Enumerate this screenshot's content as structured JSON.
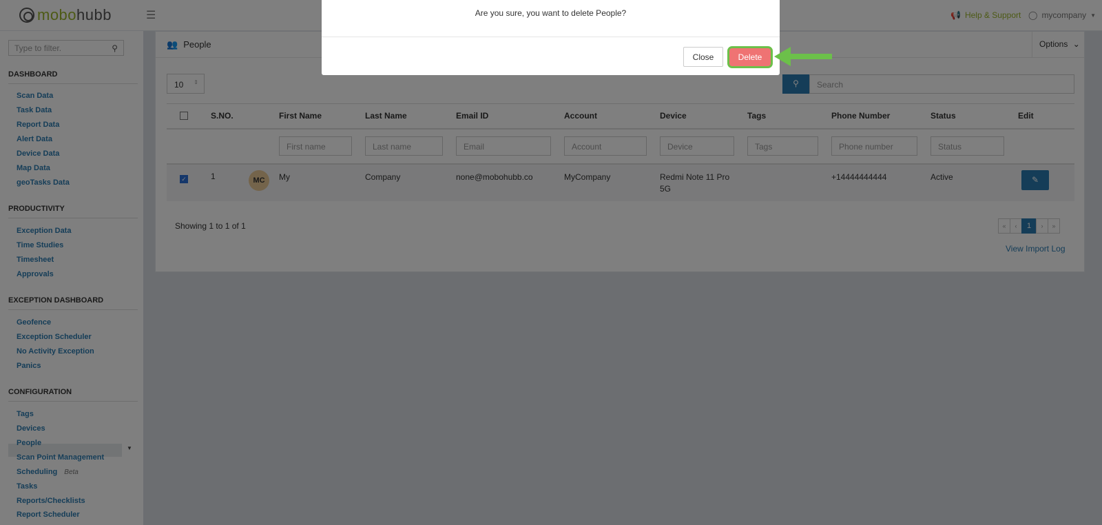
{
  "header": {
    "logo_part1": "mobo",
    "logo_part2": "hubb",
    "help_label": "Help & Support",
    "user_label": "mycompany"
  },
  "sidebar": {
    "filter_placeholder": "Type to filter.",
    "sections": {
      "dashboard": "DASHBOARD",
      "productivity": "PRODUCTIVITY",
      "exception": "EXCEPTION DASHBOARD",
      "configuration": "CONFIGURATION"
    },
    "dashboard_items": [
      "Scan Data",
      "Task Data",
      "Report Data",
      "Alert Data",
      "Device Data",
      "Map Data",
      "geoTasks Data"
    ],
    "productivity_items": [
      "Exception Data",
      "Time Studies",
      "Timesheet",
      "Approvals"
    ],
    "exception_items": [
      "Geofence",
      "Exception Scheduler",
      "No Activity Exception",
      "Panics"
    ],
    "configuration_items": [
      "Tags",
      "Devices",
      "People",
      "Scan Point Management",
      "Scheduling",
      "Tasks",
      "Reports/Checklists",
      "Report Scheduler"
    ],
    "beta_label": "Beta"
  },
  "panel": {
    "title": "People",
    "options_label": "Options",
    "page_size": "10",
    "search_placeholder": "Search",
    "columns": [
      "S.NO.",
      "First Name",
      "Last Name",
      "Email ID",
      "Account",
      "Device",
      "Tags",
      "Phone Number",
      "Status",
      "Edit"
    ],
    "filters": [
      "First name",
      "Last name",
      "Email",
      "Account",
      "Device",
      "Tags",
      "Phone number",
      "Status"
    ],
    "row": {
      "sno": "1",
      "initials": "MC",
      "first_name": "My",
      "last_name": "Company",
      "email": "none@mobohubb.co",
      "account": "MyCompany",
      "device_line1": "Redmi Note 11 Pro",
      "device_line2": "5G",
      "phone": "+14444444444",
      "status": "Active"
    },
    "showing": "Showing 1 to 1 of 1",
    "pager": [
      "«",
      "‹",
      "1",
      "›",
      "»"
    ],
    "import_log": "View Import Log"
  },
  "modal": {
    "message": "Are you sure, you want to delete People?",
    "close_label": "Close",
    "delete_label": "Delete"
  },
  "colors": {
    "accent_blue": "#2a7bb0",
    "brand_green": "#9bb52c",
    "delete_red": "#ef7373",
    "highlight_green": "#6cc04a"
  }
}
